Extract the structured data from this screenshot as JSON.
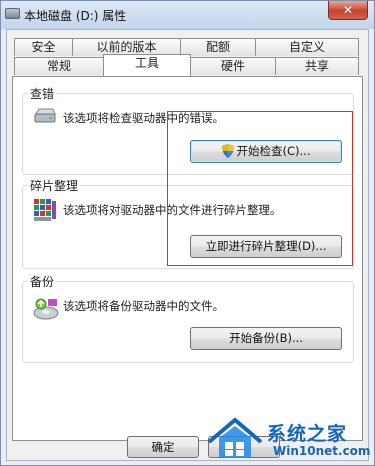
{
  "window": {
    "title": "本地磁盘 (D:) 属性",
    "close_label": "✕"
  },
  "tabs": {
    "top_row": [
      "安全",
      "以前的版本",
      "配额",
      "自定义"
    ],
    "bottom_row": [
      "常规",
      "工具",
      "硬件",
      "共享"
    ],
    "active": "工具"
  },
  "groups": {
    "check": {
      "label": "查错",
      "description": "该选项将检查驱动器中的错误。",
      "button": "开始检查(C)..."
    },
    "defrag": {
      "label": "碎片整理",
      "description": "该选项将对驱动器中的文件进行碎片整理。",
      "button": "立即进行碎片整理(D)..."
    },
    "backup": {
      "label": "备份",
      "description": "该选项将备份驱动器中的文件。",
      "button": "开始备份(B)..."
    }
  },
  "footer": {
    "ok_label": "确定"
  },
  "watermark": {
    "name": "系统之家",
    "url": "Win10net.com"
  },
  "colors": {
    "highlight_border": "#c0392b",
    "watermark": "#1565c0"
  }
}
